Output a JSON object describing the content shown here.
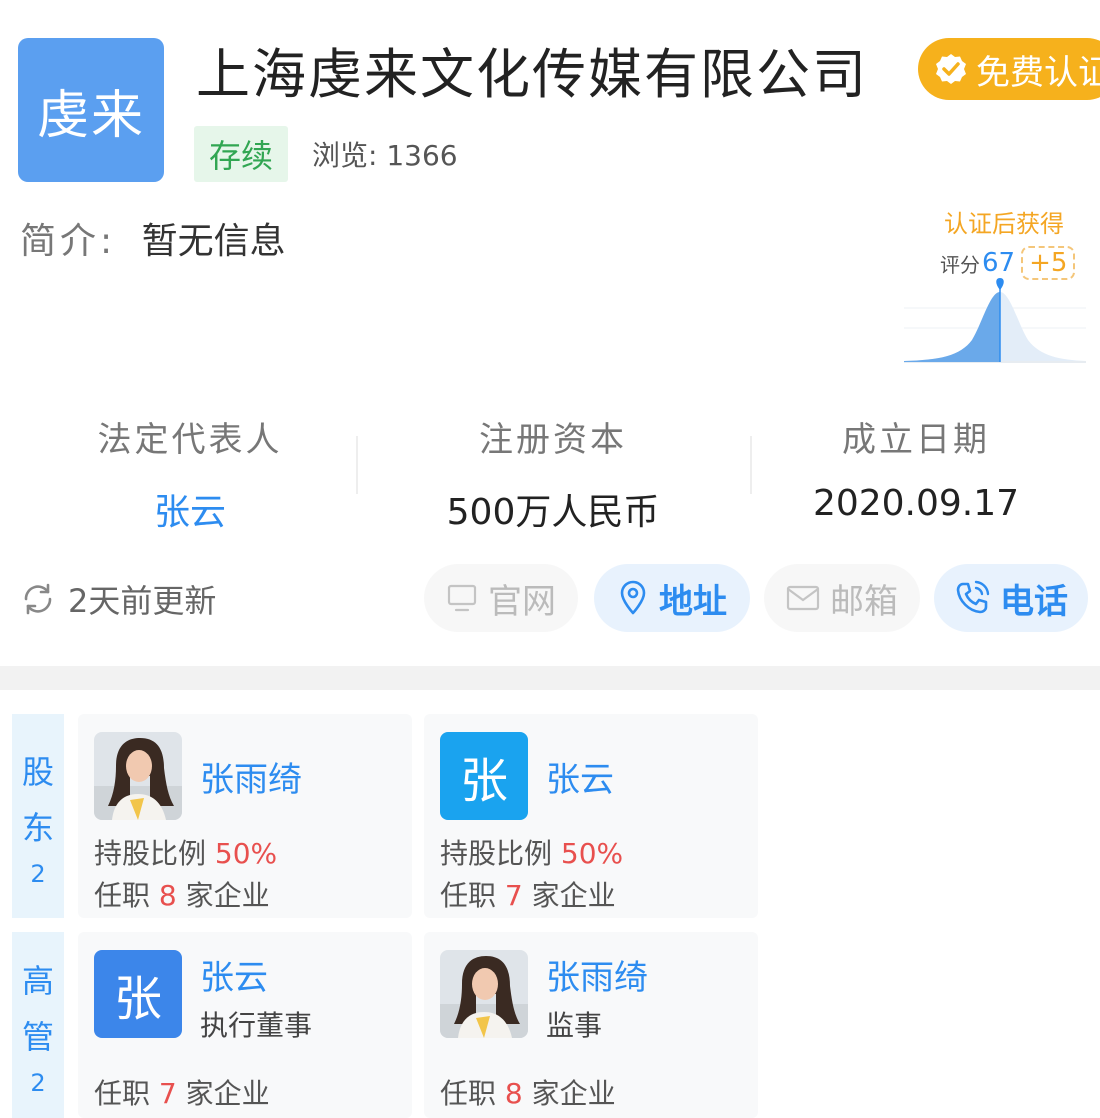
{
  "company": {
    "logo_text": "虔来",
    "name": "上海虔来文化传媒有限公司",
    "certify_button": "免费认证",
    "status": "存续",
    "views_label": "浏览:",
    "views_count": "1366",
    "intro_label": "简介:",
    "intro_value": "暂无信息"
  },
  "score": {
    "promo": "认证后获得",
    "label": "评分",
    "value": "67",
    "bonus": "+5",
    "progress_percent": 67
  },
  "stats": [
    {
      "label": "法定代表人",
      "value": "张云"
    },
    {
      "label": "注册资本",
      "value": "500万人民币"
    },
    {
      "label": "成立日期",
      "value": "2020.09.17"
    }
  ],
  "update_text": "2天前更新",
  "actions": {
    "website": "官网",
    "address": "地址",
    "email": "邮箱",
    "phone": "电话"
  },
  "shareholders": {
    "tab_title": [
      "股",
      "东"
    ],
    "count": "2",
    "items": [
      {
        "name": "张雨绮",
        "share_label": "持股比例",
        "share_value": "50%",
        "job_prefix": "任职",
        "job_count": "8",
        "job_suffix": "家企业"
      },
      {
        "name": "张云",
        "avatar_letter": "张",
        "share_label": "持股比例",
        "share_value": "50%",
        "job_prefix": "任职",
        "job_count": "7",
        "job_suffix": "家企业"
      }
    ]
  },
  "executives": {
    "tab_title": [
      "高",
      "管"
    ],
    "count": "2",
    "items": [
      {
        "name": "张云",
        "avatar_letter": "张",
        "role": "执行董事",
        "job_prefix": "任职",
        "job_count": "7",
        "job_suffix": "家企业"
      },
      {
        "name": "张雨绮",
        "role": "监事",
        "job_prefix": "任职",
        "job_count": "8",
        "job_suffix": "家企业"
      }
    ]
  },
  "colors": {
    "brand_blue": "#2d8cf0",
    "logo_blue": "#5b9ff0",
    "cert_orange": "#f6b11c",
    "status_green": "#31a652",
    "highlight_red": "#e8504e",
    "avatar_cyan": "#1aa3ef",
    "avatar_blue": "#3c86ea"
  }
}
